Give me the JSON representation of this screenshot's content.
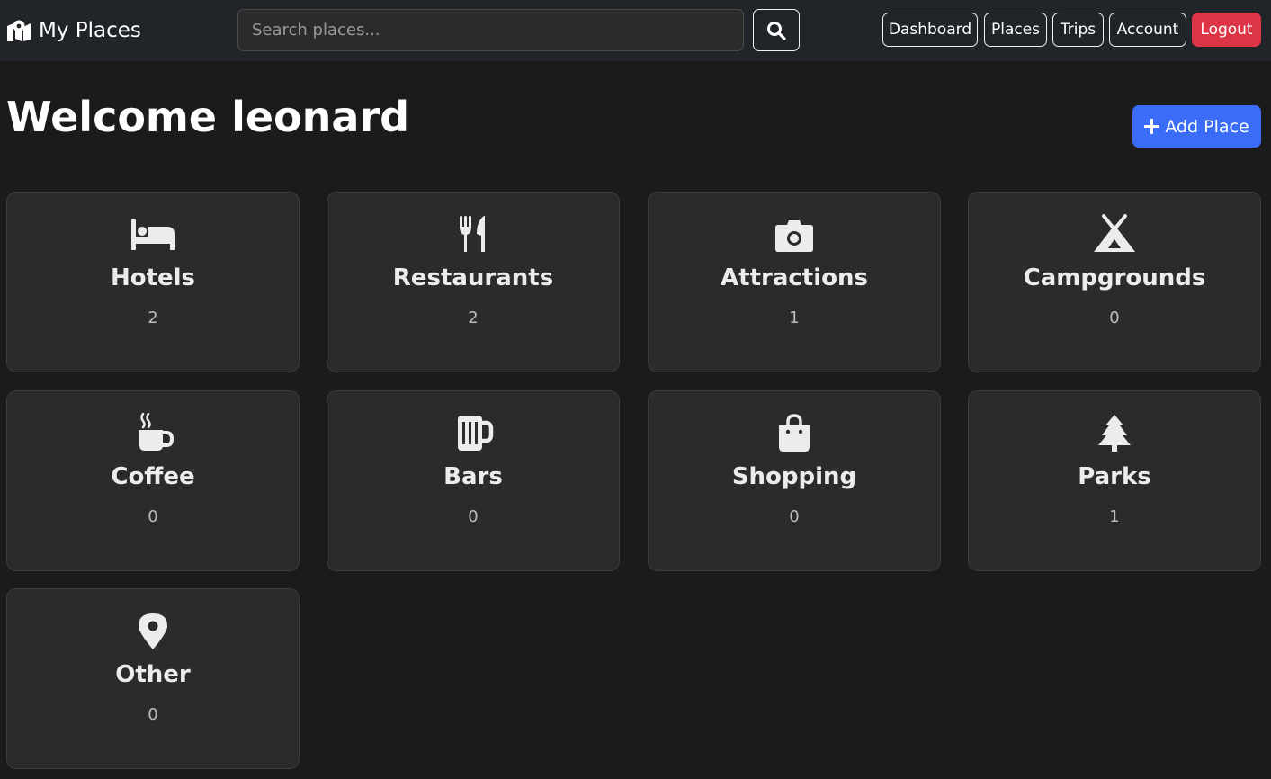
{
  "navbar": {
    "brand": "My Places",
    "brand_icon": "map-location-icon",
    "search": {
      "placeholder": "Search places...",
      "value": ""
    },
    "search_icon": "search-icon",
    "links": [
      "Dashboard",
      "Places",
      "Trips",
      "Account"
    ],
    "logout": "Logout"
  },
  "main": {
    "title": "Welcome leonard",
    "add_button": "Add Place",
    "add_icon": "plus-icon"
  },
  "categories": [
    {
      "name": "Hotels",
      "count": "2",
      "icon": "bed-icon"
    },
    {
      "name": "Restaurants",
      "count": "2",
      "icon": "utensils-icon"
    },
    {
      "name": "Attractions",
      "count": "1",
      "icon": "camera-icon"
    },
    {
      "name": "Campgrounds",
      "count": "0",
      "icon": "tent-icon"
    },
    {
      "name": "Coffee",
      "count": "0",
      "icon": "coffee-mug-icon"
    },
    {
      "name": "Bars",
      "count": "0",
      "icon": "beer-mug-icon"
    },
    {
      "name": "Shopping",
      "count": "0",
      "icon": "shopping-bag-icon"
    },
    {
      "name": "Parks",
      "count": "1",
      "icon": "tree-icon"
    },
    {
      "name": "Other",
      "count": "0",
      "icon": "location-pin-icon"
    }
  ],
  "colors": {
    "background": "#1b1b1b",
    "navbar": "#212529",
    "card": "#2b2b2b",
    "primary": "#3b6cf7",
    "danger": "#dc3545"
  }
}
